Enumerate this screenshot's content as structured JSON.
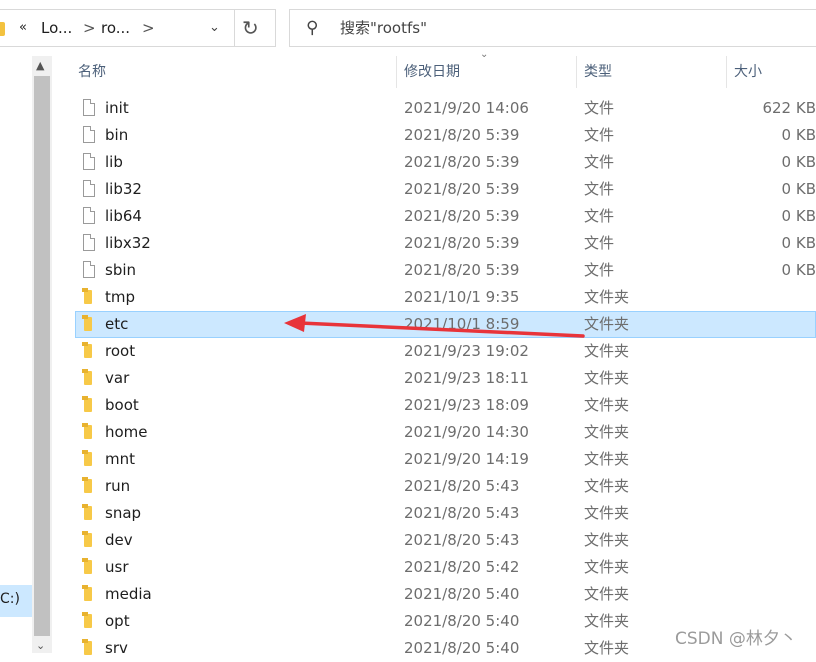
{
  "address_bar": {
    "overflow": "«",
    "crumbs": [
      "Lo...",
      "ro..."
    ],
    "separator": ">",
    "dropdown": "⌄",
    "refresh": "↻"
  },
  "search": {
    "placeholder": "搜索\"rootfs\""
  },
  "nav": {
    "selected_label": "C:)",
    "scroll_up": "▲",
    "scroll_down": "⌄"
  },
  "columns": {
    "name": "名称",
    "date": "修改日期",
    "type": "类型",
    "size": "大小",
    "sort_indicator": "⌄"
  },
  "files": [
    {
      "name": "init",
      "date": "2021/9/20 14:06",
      "type": "文件",
      "size": "622 KB",
      "kind": "file"
    },
    {
      "name": "bin",
      "date": "2021/8/20 5:39",
      "type": "文件",
      "size": "0 KB",
      "kind": "file"
    },
    {
      "name": "lib",
      "date": "2021/8/20 5:39",
      "type": "文件",
      "size": "0 KB",
      "kind": "file"
    },
    {
      "name": "lib32",
      "date": "2021/8/20 5:39",
      "type": "文件",
      "size": "0 KB",
      "kind": "file"
    },
    {
      "name": "lib64",
      "date": "2021/8/20 5:39",
      "type": "文件",
      "size": "0 KB",
      "kind": "file"
    },
    {
      "name": "libx32",
      "date": "2021/8/20 5:39",
      "type": "文件",
      "size": "0 KB",
      "kind": "file"
    },
    {
      "name": "sbin",
      "date": "2021/8/20 5:39",
      "type": "文件",
      "size": "0 KB",
      "kind": "file"
    },
    {
      "name": "tmp",
      "date": "2021/10/1 9:35",
      "type": "文件夹",
      "size": "",
      "kind": "folder"
    },
    {
      "name": "etc",
      "date": "2021/10/1 8:59",
      "type": "文件夹",
      "size": "",
      "kind": "folder",
      "selected": true
    },
    {
      "name": "root",
      "date": "2021/9/23 19:02",
      "type": "文件夹",
      "size": "",
      "kind": "folder"
    },
    {
      "name": "var",
      "date": "2021/9/23 18:11",
      "type": "文件夹",
      "size": "",
      "kind": "folder"
    },
    {
      "name": "boot",
      "date": "2021/9/23 18:09",
      "type": "文件夹",
      "size": "",
      "kind": "folder"
    },
    {
      "name": "home",
      "date": "2021/9/20 14:30",
      "type": "文件夹",
      "size": "",
      "kind": "folder"
    },
    {
      "name": "mnt",
      "date": "2021/9/20 14:19",
      "type": "文件夹",
      "size": "",
      "kind": "folder"
    },
    {
      "name": "run",
      "date": "2021/8/20 5:43",
      "type": "文件夹",
      "size": "",
      "kind": "folder"
    },
    {
      "name": "snap",
      "date": "2021/8/20 5:43",
      "type": "文件夹",
      "size": "",
      "kind": "folder"
    },
    {
      "name": "dev",
      "date": "2021/8/20 5:43",
      "type": "文件夹",
      "size": "",
      "kind": "folder"
    },
    {
      "name": "usr",
      "date": "2021/8/20 5:42",
      "type": "文件夹",
      "size": "",
      "kind": "folder"
    },
    {
      "name": "media",
      "date": "2021/8/20 5:40",
      "type": "文件夹",
      "size": "",
      "kind": "folder"
    },
    {
      "name": "opt",
      "date": "2021/8/20 5:40",
      "type": "文件夹",
      "size": "",
      "kind": "folder"
    },
    {
      "name": "srv",
      "date": "2021/8/20 5:40",
      "type": "文件夹",
      "size": "",
      "kind": "folder"
    }
  ],
  "annotation": {
    "color": "#e8343a",
    "points_to": "etc"
  },
  "watermark": "CSDN @林夕丶",
  "colors": {
    "selection": "#cce8ff",
    "folder": "#f7c948",
    "header_text": "#4c607a"
  }
}
